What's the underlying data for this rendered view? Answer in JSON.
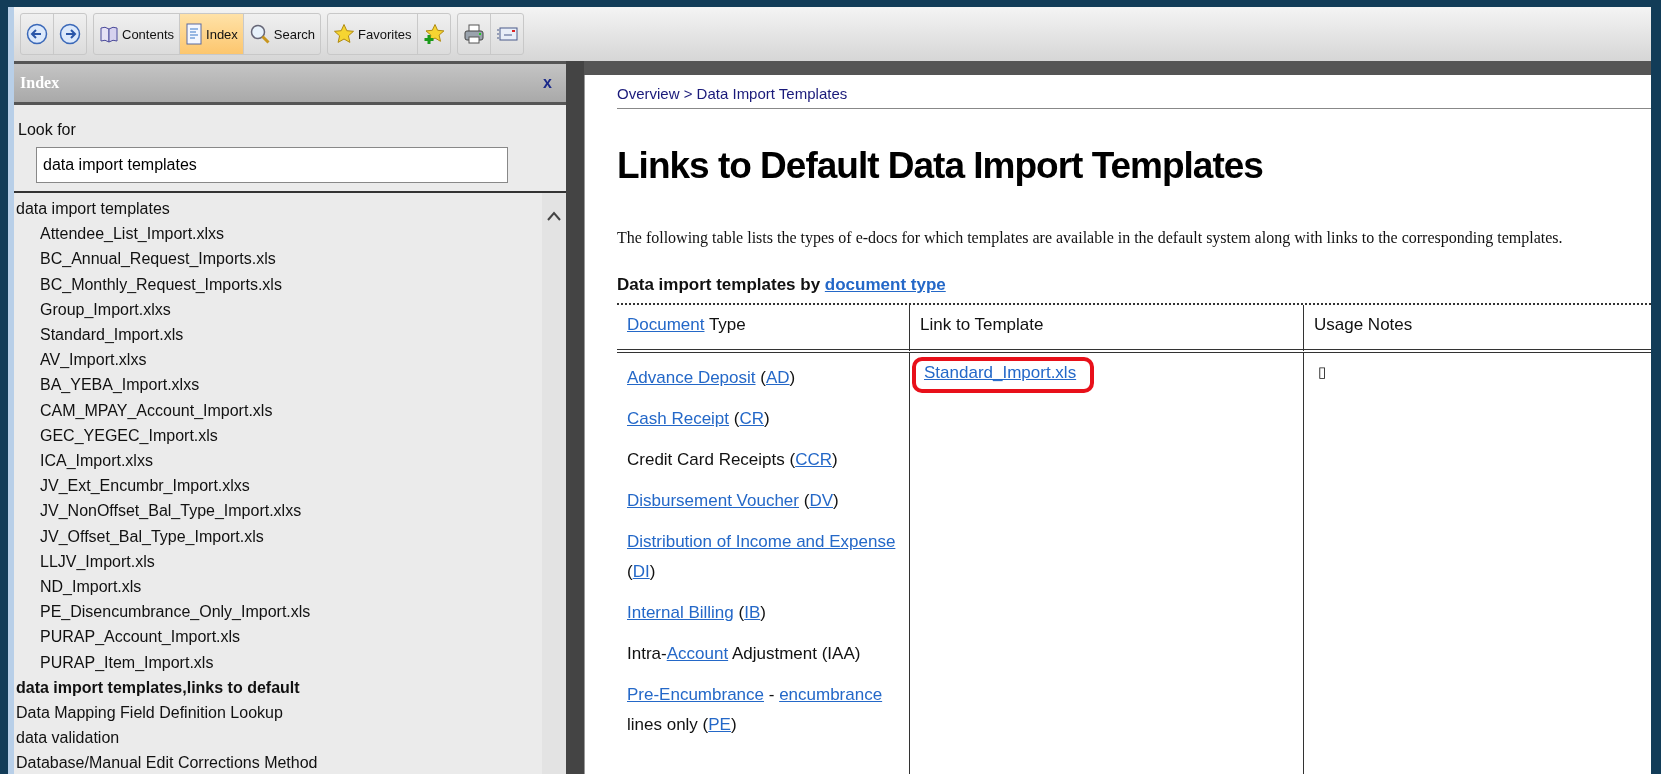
{
  "toolbar": {
    "groups": [
      {
        "buttons": [
          {
            "kind": "back",
            "selected": false
          },
          {
            "kind": "forward",
            "selected": false
          }
        ]
      },
      {
        "buttons": [
          {
            "kind": "contents",
            "label": "Contents",
            "selected": false
          },
          {
            "kind": "index",
            "label": "Index",
            "selected": true
          },
          {
            "kind": "search",
            "label": "Search",
            "selected": false
          }
        ]
      },
      {
        "buttons": [
          {
            "kind": "favorites",
            "label": "Favorites",
            "selected": false
          },
          {
            "kind": "add-favorite",
            "selected": false
          }
        ]
      },
      {
        "buttons": [
          {
            "kind": "print",
            "selected": false
          },
          {
            "kind": "options",
            "selected": false
          }
        ]
      }
    ]
  },
  "index_pane": {
    "title": "Index",
    "close": "x",
    "look_for_label": "Look for",
    "search_value": "data import templates",
    "items": [
      {
        "label": "data import templates",
        "selected": false,
        "children": [
          {
            "label": "Attendee_List_Import.xlxs",
            "selected": false
          },
          {
            "label": "BC_Annual_Request_Imports.xls",
            "selected": false
          },
          {
            "label": "BC_Monthly_Request_Imports.xls",
            "selected": false
          },
          {
            "label": "Group_Import.xlxs",
            "selected": false
          },
          {
            "label": "Standard_Import.xls",
            "selected": false
          },
          {
            "label": "AV_Import.xlxs",
            "selected": false
          },
          {
            "label": "BA_YEBA_Import.xlxs",
            "selected": false
          },
          {
            "label": "CAM_MPAY_Account_Import.xls",
            "selected": false
          },
          {
            "label": "GEC_YEGEC_Import.xls",
            "selected": false
          },
          {
            "label": "ICA_Import.xlxs",
            "selected": false
          },
          {
            "label": "JV_Ext_Encumbr_Import.xlxs",
            "selected": false
          },
          {
            "label": "JV_NonOffset_Bal_Type_Import.xlxs",
            "selected": false
          },
          {
            "label": "JV_Offset_Bal_Type_Import.xls",
            "selected": false
          },
          {
            "label": "LLJV_Import.xls",
            "selected": false
          },
          {
            "label": "ND_Import.xls",
            "selected": false
          },
          {
            "label": "PE_Disencumbrance_Only_Import.xls",
            "selected": false
          },
          {
            "label": "PURAP_Account_Import.xls",
            "selected": false
          },
          {
            "label": "PURAP_Item_Import.xls",
            "selected": false
          }
        ]
      },
      {
        "label": "data import templates,links to default",
        "selected": true
      },
      {
        "label": "Data Mapping Field Definition Lookup",
        "selected": false
      },
      {
        "label": "data validation",
        "selected": false
      },
      {
        "label": "Database/Manual Edit Corrections Method",
        "selected": false
      }
    ]
  },
  "content": {
    "breadcrumb": "Overview > Data Import Templates",
    "title": "Links to Default Data Import Templates",
    "description": "The following table lists the types of e-docs for which templates are available in the default system along with links to the corresponding templates.",
    "table_caption": [
      {
        "text": "Data import templates by ",
        "link": false
      },
      {
        "text": "document type",
        "link": true
      }
    ],
    "table": {
      "columns": [
        [
          {
            "text": "Document",
            "link": true
          },
          {
            "text": " Type",
            "link": false
          }
        ],
        [
          {
            "text": "Link to Template",
            "link": false
          }
        ],
        [
          {
            "text": "Usage Notes",
            "link": false
          }
        ]
      ],
      "document_types": [
        [
          {
            "text": "Advance Deposit",
            "link": true
          },
          {
            "text": " (",
            "link": false
          },
          {
            "text": "AD",
            "link": true
          },
          {
            "text": ")",
            "link": false
          }
        ],
        [
          {
            "text": "Cash Receipt",
            "link": true
          },
          {
            "text": " (",
            "link": false
          },
          {
            "text": "CR",
            "link": true
          },
          {
            "text": ")",
            "link": false
          }
        ],
        [
          {
            "text": "Credit Card Receipts (",
            "link": false
          },
          {
            "text": "CCR",
            "link": true
          },
          {
            "text": ")",
            "link": false
          }
        ],
        [
          {
            "text": "Disbursement Voucher",
            "link": true
          },
          {
            "text": " (",
            "link": false
          },
          {
            "text": "DV",
            "link": true
          },
          {
            "text": ")",
            "link": false
          }
        ],
        [
          {
            "text": "Distribution of Income and Expense",
            "link": true
          },
          {
            "text": " (",
            "link": false
          },
          {
            "text": "DI",
            "link": true
          },
          {
            "text": ")",
            "link": false
          }
        ],
        [
          {
            "text": "Internal Billing",
            "link": true
          },
          {
            "text": " (",
            "link": false
          },
          {
            "text": "IB",
            "link": true
          },
          {
            "text": ")",
            "link": false
          }
        ],
        [
          {
            "text": "Intra-",
            "link": false
          },
          {
            "text": "Account",
            "link": true
          },
          {
            "text": " Adjustment (IAA)",
            "link": false
          }
        ],
        [
          {
            "text": "Pre-Encumbrance",
            "link": true
          },
          {
            "text": " - ",
            "link": false
          },
          {
            "text": "encumbrance",
            "link": true
          },
          {
            "text": " lines only (",
            "link": false
          },
          {
            "text": "PE",
            "link": true
          },
          {
            "text": ")",
            "link": false
          }
        ]
      ],
      "template_link": {
        "text": "Standard_Import.xls",
        "highlighted": true
      },
      "usage_notes": "▯"
    }
  }
}
